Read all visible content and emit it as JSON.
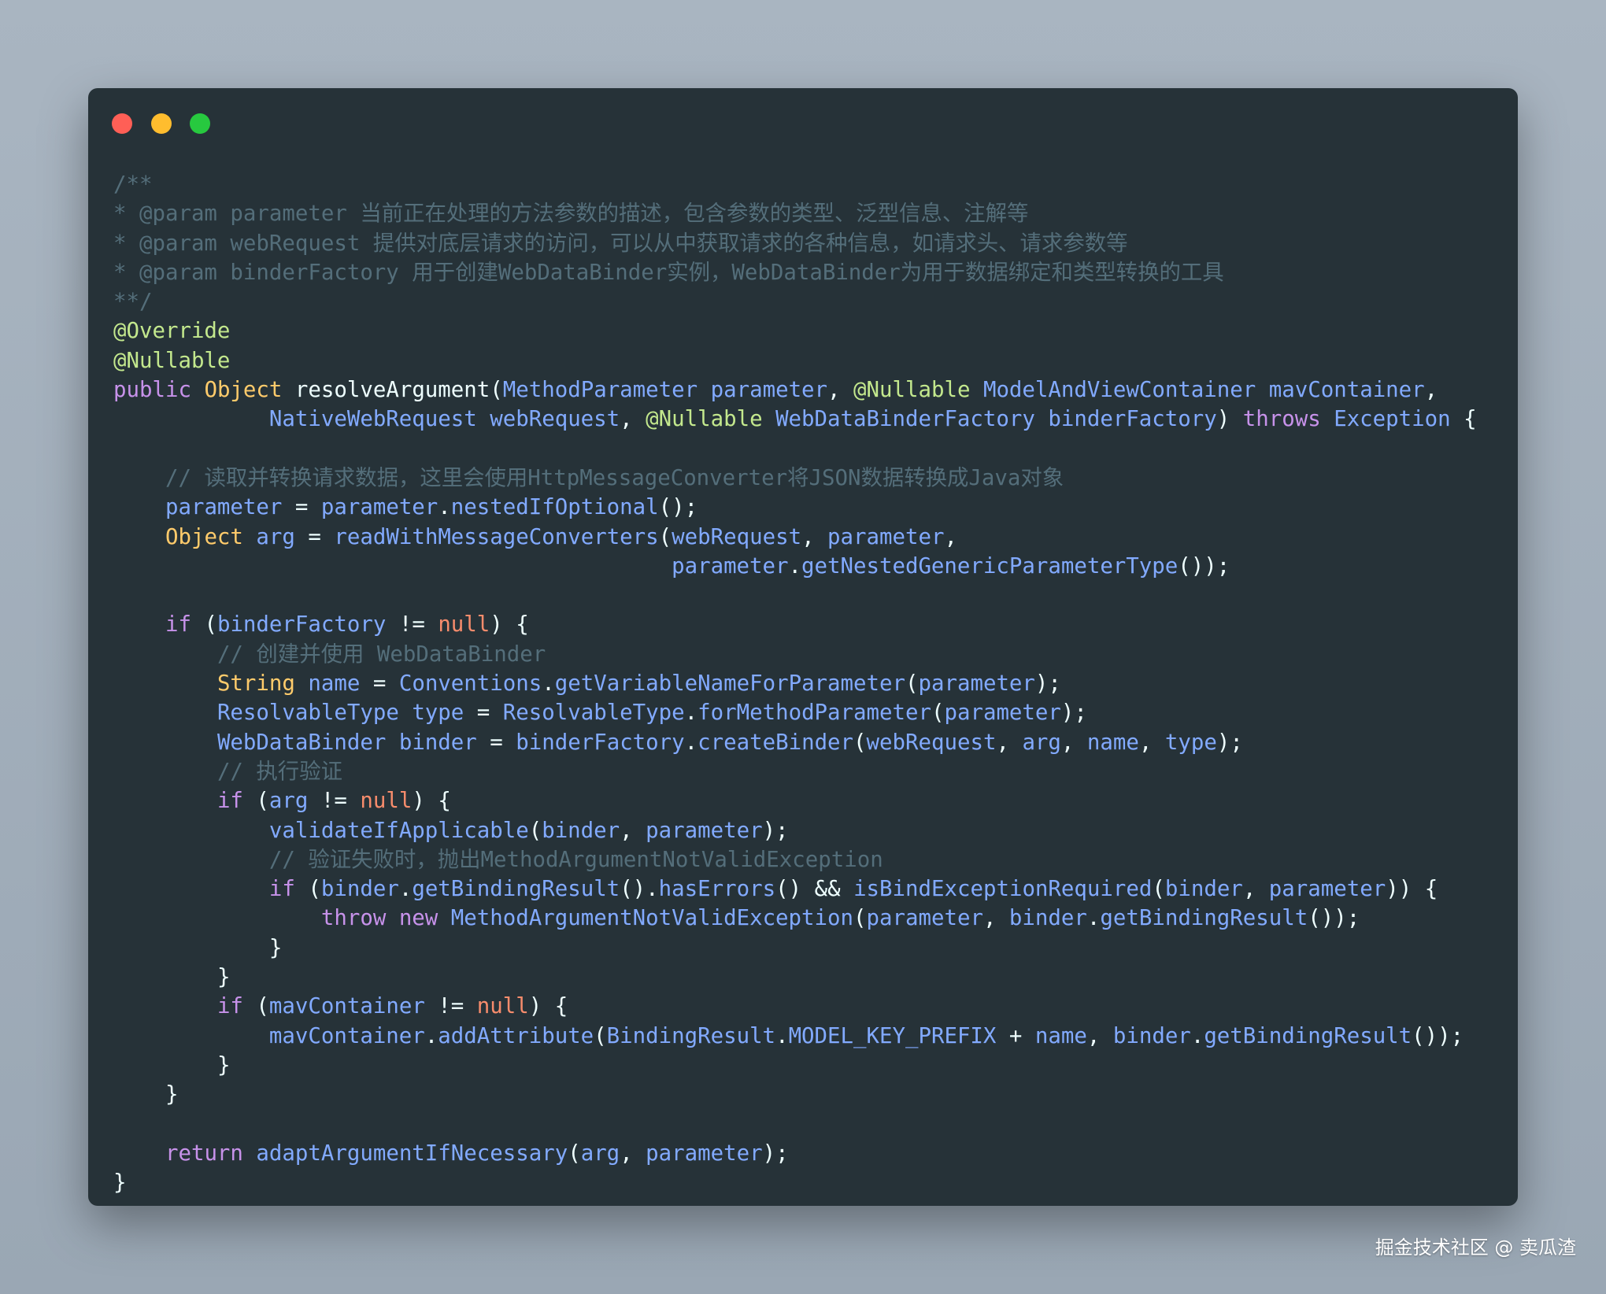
{
  "window": {
    "controls": [
      {
        "name": "close-button",
        "color": "#ff5f56"
      },
      {
        "name": "minimize-button",
        "color": "#ffbd2e"
      },
      {
        "name": "maximize-button",
        "color": "#27c93f"
      }
    ],
    "theme": {
      "background": "#263238",
      "comment": "#546e7a",
      "annotation": "#c3e88d",
      "keyword": "#c792ea",
      "type": "#ffcb6b",
      "identifier": "#82aaff",
      "literal": "#f78c6c",
      "punctuation": "#eeffff"
    }
  },
  "code_lines": [
    [
      [
        "comment",
        "/**"
      ]
    ],
    [
      [
        "comment",
        "* @param parameter 当前正在处理的方法参数的描述，包含参数的类型、泛型信息、注解等"
      ]
    ],
    [
      [
        "comment",
        "* @param webRequest 提供对底层请求的访问，可以从中获取请求的各种信息，如请求头、请求参数等"
      ]
    ],
    [
      [
        "comment",
        "* @param binderFactory 用于创建WebDataBinder实例，WebDataBinder为用于数据绑定和类型转换的工具"
      ]
    ],
    [
      [
        "comment",
        "**/"
      ]
    ],
    [
      [
        "annotation",
        "@Override"
      ]
    ],
    [
      [
        "annotation",
        "@Nullable"
      ]
    ],
    [
      [
        "keyword",
        "public"
      ],
      [
        "plain",
        " "
      ],
      [
        "type",
        "Object"
      ],
      [
        "plain",
        " "
      ],
      [
        "plain",
        "resolveArgument"
      ],
      [
        "punct",
        "("
      ],
      [
        "class",
        "MethodParameter"
      ],
      [
        "plain",
        " "
      ],
      [
        "param",
        "parameter"
      ],
      [
        "punct",
        ", "
      ],
      [
        "annotation",
        "@Nullable"
      ],
      [
        "plain",
        " "
      ],
      [
        "class",
        "ModelAndViewContainer"
      ],
      [
        "plain",
        " "
      ],
      [
        "param",
        "mavContainer"
      ],
      [
        "punct",
        ","
      ]
    ],
    [
      [
        "plain",
        "            "
      ],
      [
        "class",
        "NativeWebRequest"
      ],
      [
        "plain",
        " "
      ],
      [
        "param",
        "webRequest"
      ],
      [
        "punct",
        ", "
      ],
      [
        "annotation",
        "@Nullable"
      ],
      [
        "plain",
        " "
      ],
      [
        "class",
        "WebDataBinderFactory"
      ],
      [
        "plain",
        " "
      ],
      [
        "param",
        "binderFactory"
      ],
      [
        "punct",
        ") "
      ],
      [
        "keyword",
        "throws"
      ],
      [
        "plain",
        " "
      ],
      [
        "class",
        "Exception"
      ],
      [
        "plain",
        " "
      ],
      [
        "punct",
        "{"
      ]
    ],
    [],
    [
      [
        "plain",
        "    "
      ],
      [
        "comment",
        "// 读取并转换请求数据，这里会使用HttpMessageConverter将JSON数据转换成Java对象"
      ]
    ],
    [
      [
        "plain",
        "    "
      ],
      [
        "var",
        "parameter"
      ],
      [
        "operator",
        " = "
      ],
      [
        "var",
        "parameter"
      ],
      [
        "punct",
        "."
      ],
      [
        "method",
        "nestedIfOptional"
      ],
      [
        "punct",
        "();"
      ]
    ],
    [
      [
        "plain",
        "    "
      ],
      [
        "type",
        "Object"
      ],
      [
        "plain",
        " "
      ],
      [
        "var",
        "arg"
      ],
      [
        "operator",
        " = "
      ],
      [
        "method",
        "readWithMessageConverters"
      ],
      [
        "punct",
        "("
      ],
      [
        "var",
        "webRequest"
      ],
      [
        "punct",
        ", "
      ],
      [
        "var",
        "parameter"
      ],
      [
        "punct",
        ","
      ]
    ],
    [
      [
        "plain",
        "                                           "
      ],
      [
        "var",
        "parameter"
      ],
      [
        "punct",
        "."
      ],
      [
        "method",
        "getNestedGenericParameterType"
      ],
      [
        "punct",
        "());"
      ]
    ],
    [],
    [
      [
        "plain",
        "    "
      ],
      [
        "keyword",
        "if"
      ],
      [
        "plain",
        " "
      ],
      [
        "punct",
        "("
      ],
      [
        "var",
        "binderFactory"
      ],
      [
        "operator",
        " != "
      ],
      [
        "literal",
        "null"
      ],
      [
        "punct",
        ") {"
      ]
    ],
    [
      [
        "plain",
        "        "
      ],
      [
        "comment",
        "// 创建并使用 WebDataBinder"
      ]
    ],
    [
      [
        "plain",
        "        "
      ],
      [
        "type",
        "String"
      ],
      [
        "plain",
        " "
      ],
      [
        "var",
        "name"
      ],
      [
        "operator",
        " = "
      ],
      [
        "class",
        "Conventions"
      ],
      [
        "punct",
        "."
      ],
      [
        "method",
        "getVariableNameForParameter"
      ],
      [
        "punct",
        "("
      ],
      [
        "var",
        "parameter"
      ],
      [
        "punct",
        ");"
      ]
    ],
    [
      [
        "plain",
        "        "
      ],
      [
        "class",
        "ResolvableType"
      ],
      [
        "plain",
        " "
      ],
      [
        "var",
        "type"
      ],
      [
        "operator",
        " = "
      ],
      [
        "class",
        "ResolvableType"
      ],
      [
        "punct",
        "."
      ],
      [
        "method",
        "forMethodParameter"
      ],
      [
        "punct",
        "("
      ],
      [
        "var",
        "parameter"
      ],
      [
        "punct",
        ");"
      ]
    ],
    [
      [
        "plain",
        "        "
      ],
      [
        "class",
        "WebDataBinder"
      ],
      [
        "plain",
        " "
      ],
      [
        "var",
        "binder"
      ],
      [
        "operator",
        " = "
      ],
      [
        "var",
        "binderFactory"
      ],
      [
        "punct",
        "."
      ],
      [
        "method",
        "createBinder"
      ],
      [
        "punct",
        "("
      ],
      [
        "var",
        "webRequest"
      ],
      [
        "punct",
        ", "
      ],
      [
        "var",
        "arg"
      ],
      [
        "punct",
        ", "
      ],
      [
        "var",
        "name"
      ],
      [
        "punct",
        ", "
      ],
      [
        "var",
        "type"
      ],
      [
        "punct",
        ");"
      ]
    ],
    [
      [
        "plain",
        "        "
      ],
      [
        "comment",
        "// 执行验证"
      ]
    ],
    [
      [
        "plain",
        "        "
      ],
      [
        "keyword",
        "if"
      ],
      [
        "plain",
        " "
      ],
      [
        "punct",
        "("
      ],
      [
        "var",
        "arg"
      ],
      [
        "operator",
        " != "
      ],
      [
        "literal",
        "null"
      ],
      [
        "punct",
        ") {"
      ]
    ],
    [
      [
        "plain",
        "            "
      ],
      [
        "method",
        "validateIfApplicable"
      ],
      [
        "punct",
        "("
      ],
      [
        "var",
        "binder"
      ],
      [
        "punct",
        ", "
      ],
      [
        "var",
        "parameter"
      ],
      [
        "punct",
        ");"
      ]
    ],
    [
      [
        "plain",
        "            "
      ],
      [
        "comment",
        "// 验证失败时，抛出MethodArgumentNotValidException"
      ]
    ],
    [
      [
        "plain",
        "            "
      ],
      [
        "keyword",
        "if"
      ],
      [
        "plain",
        " "
      ],
      [
        "punct",
        "("
      ],
      [
        "var",
        "binder"
      ],
      [
        "punct",
        "."
      ],
      [
        "method",
        "getBindingResult"
      ],
      [
        "punct",
        "()."
      ],
      [
        "method",
        "hasErrors"
      ],
      [
        "punct",
        "() "
      ],
      [
        "operator",
        "&&"
      ],
      [
        "plain",
        " "
      ],
      [
        "method",
        "isBindExceptionRequired"
      ],
      [
        "punct",
        "("
      ],
      [
        "var",
        "binder"
      ],
      [
        "punct",
        ", "
      ],
      [
        "var",
        "parameter"
      ],
      [
        "punct",
        ")) {"
      ]
    ],
    [
      [
        "plain",
        "                "
      ],
      [
        "keyword",
        "throw"
      ],
      [
        "plain",
        " "
      ],
      [
        "keyword",
        "new"
      ],
      [
        "plain",
        " "
      ],
      [
        "class",
        "MethodArgumentNotValidException"
      ],
      [
        "punct",
        "("
      ],
      [
        "var",
        "parameter"
      ],
      [
        "punct",
        ", "
      ],
      [
        "var",
        "binder"
      ],
      [
        "punct",
        "."
      ],
      [
        "method",
        "getBindingResult"
      ],
      [
        "punct",
        "());"
      ]
    ],
    [
      [
        "plain",
        "            "
      ],
      [
        "punct",
        "}"
      ]
    ],
    [
      [
        "plain",
        "        "
      ],
      [
        "punct",
        "}"
      ]
    ],
    [
      [
        "plain",
        "        "
      ],
      [
        "keyword",
        "if"
      ],
      [
        "plain",
        " "
      ],
      [
        "punct",
        "("
      ],
      [
        "var",
        "mavContainer"
      ],
      [
        "operator",
        " != "
      ],
      [
        "literal",
        "null"
      ],
      [
        "punct",
        ") {"
      ]
    ],
    [
      [
        "plain",
        "            "
      ],
      [
        "var",
        "mavContainer"
      ],
      [
        "punct",
        "."
      ],
      [
        "method",
        "addAttribute"
      ],
      [
        "punct",
        "("
      ],
      [
        "class",
        "BindingResult"
      ],
      [
        "punct",
        "."
      ],
      [
        "var",
        "MODEL_KEY_PREFIX"
      ],
      [
        "operator",
        " + "
      ],
      [
        "var",
        "name"
      ],
      [
        "punct",
        ", "
      ],
      [
        "var",
        "binder"
      ],
      [
        "punct",
        "."
      ],
      [
        "method",
        "getBindingResult"
      ],
      [
        "punct",
        "());"
      ]
    ],
    [
      [
        "plain",
        "        "
      ],
      [
        "punct",
        "}"
      ]
    ],
    [
      [
        "plain",
        "    "
      ],
      [
        "punct",
        "}"
      ]
    ],
    [],
    [
      [
        "plain",
        "    "
      ],
      [
        "keyword",
        "return"
      ],
      [
        "plain",
        " "
      ],
      [
        "method",
        "adaptArgumentIfNecessary"
      ],
      [
        "punct",
        "("
      ],
      [
        "var",
        "arg"
      ],
      [
        "punct",
        ", "
      ],
      [
        "var",
        "parameter"
      ],
      [
        "punct",
        ");"
      ]
    ],
    [
      [
        "punct",
        "}"
      ]
    ]
  ],
  "watermark": "掘金技术社区 @ 卖瓜渣"
}
